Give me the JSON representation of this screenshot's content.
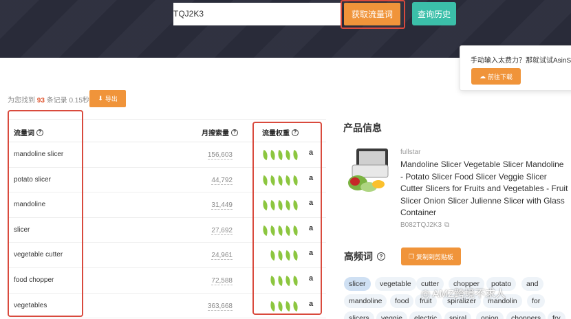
{
  "search": {
    "value": "TQJ2K3",
    "get_button": "获取流量词",
    "history_button": "查询历史"
  },
  "promo": {
    "text": "手动输入太费力？那就试试AsinSee",
    "button": "前往下载"
  },
  "stats": {
    "prefix": "为您找到",
    "count": "93",
    "suffix": "条记录 0.15秒",
    "export": "导出"
  },
  "table": {
    "headers": {
      "keyword": "流量词",
      "volume": "月搜索量",
      "weight": "流量权重"
    },
    "rows": [
      {
        "keyword": "mandoline slicer",
        "volume": "156,603",
        "weight": 5
      },
      {
        "keyword": "potato slicer",
        "volume": "44,792",
        "weight": 5
      },
      {
        "keyword": "mandoline",
        "volume": "31,449",
        "weight": 5
      },
      {
        "keyword": "slicer",
        "volume": "27,692",
        "weight": 5
      },
      {
        "keyword": "vegetable cutter",
        "volume": "24,961",
        "weight": 4
      },
      {
        "keyword": "food chopper",
        "volume": "72,588",
        "weight": 4
      },
      {
        "keyword": "vegetables",
        "volume": "363,668",
        "weight": 4
      }
    ]
  },
  "product": {
    "section_title": "产品信息",
    "brand": "fullstar",
    "name": "Mandoline Slicer Vegetable Slicer Mandoline - Potato Slicer Food Slicer Veggie Slicer Cutter Slicers for Fruits and Vegetables - Fruit Slicer Onion Slicer Julienne Slicer with Glass Container",
    "asin": "B082TQJ2K3"
  },
  "high_freq": {
    "title": "高频词",
    "copy_button": "复制到剪贴板",
    "tags": [
      "slicer",
      "vegetable",
      "cutter",
      "chopper",
      "potato",
      "and",
      "mandoline",
      "food",
      "fruit",
      "spiralizer",
      "mandolin",
      "for",
      "slicers",
      "veggie",
      "electric",
      "spiral",
      "onion",
      "choppers",
      "fry"
    ]
  },
  "watermark": "AMZ跨境不求人",
  "colors": {
    "accent_orange": "#f0943a",
    "teal": "#3bbfa9",
    "header_bg": "#2b2d3c",
    "highlight_red": "#d94a3d",
    "leaf_green": "#8cc63f"
  }
}
